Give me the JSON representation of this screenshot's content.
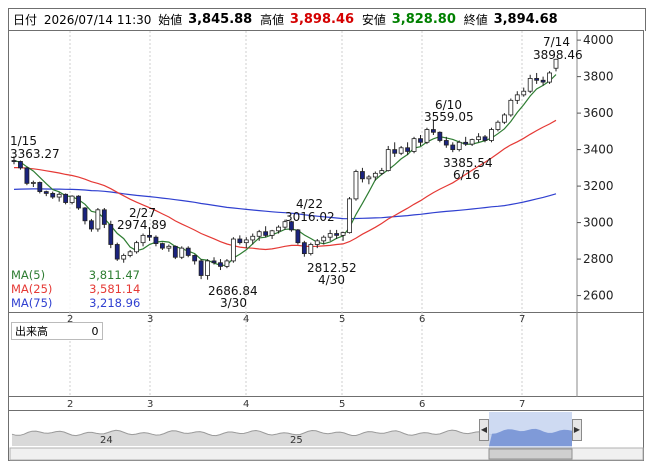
{
  "header": {
    "date_label": "日付",
    "datetime": "2026/07/14 11:30",
    "open_label": "始値",
    "open": "3,845.88",
    "high_label": "高値",
    "high": "3,898.46",
    "low_label": "安値",
    "low": "3,828.80",
    "close_label": "終値",
    "close": "3,894.68",
    "colors": {
      "high": "#d40000",
      "low": "#008000",
      "value": "#000000"
    }
  },
  "chart_data": {
    "type": "candlestick",
    "y_ticks": [
      "4000",
      "3800",
      "3600",
      "3400",
      "3200",
      "3000",
      "2800",
      "2600"
    ],
    "ylim": [
      2510,
      4050
    ],
    "x_ticks": [
      "2",
      "3",
      "4",
      "5",
      "6",
      "7"
    ],
    "annotations": [
      {
        "date": "1/15",
        "value": "3363.27"
      },
      {
        "date": "2/27",
        "value": "2974.89"
      },
      {
        "date": "3/30",
        "value": "2686.84"
      },
      {
        "date": "4/22",
        "value": "3016.02"
      },
      {
        "date": "4/30",
        "value": "2812.52"
      },
      {
        "date": "6/10",
        "value": "3559.05"
      },
      {
        "date": "6/16",
        "value": "3385.54"
      },
      {
        "date": "7/14",
        "value": "3898.46"
      }
    ],
    "ma_legend": [
      {
        "name": "MA(5)",
        "value": "3,811.47",
        "color": "#2e7d32"
      },
      {
        "name": "MA(25)",
        "value": "3,581.14",
        "color": "#e53935"
      },
      {
        "name": "MA(75)",
        "value": "3,218.96",
        "color": "#3040d0"
      }
    ],
    "candles": [
      [
        3340,
        3363,
        3320,
        3335
      ],
      [
        3335,
        3340,
        3290,
        3300
      ],
      [
        3300,
        3305,
        3205,
        3215
      ],
      [
        3215,
        3230,
        3195,
        3220
      ],
      [
        3220,
        3225,
        3160,
        3170
      ],
      [
        3170,
        3175,
        3145,
        3160
      ],
      [
        3160,
        3170,
        3130,
        3140
      ],
      [
        3140,
        3165,
        3115,
        3155
      ],
      [
        3155,
        3160,
        3100,
        3110
      ],
      [
        3110,
        3150,
        3100,
        3145
      ],
      [
        3145,
        3150,
        3070,
        3080
      ],
      [
        3080,
        3085,
        2990,
        3010
      ],
      [
        3010,
        3020,
        2950,
        2965
      ],
      [
        2965,
        3080,
        2950,
        3070
      ],
      [
        3070,
        3080,
        2970,
        2990
      ],
      [
        2990,
        3010,
        2860,
        2880
      ],
      [
        2880,
        2890,
        2790,
        2800
      ],
      [
        2800,
        2830,
        2780,
        2820
      ],
      [
        2820,
        2850,
        2810,
        2840
      ],
      [
        2840,
        2900,
        2830,
        2890
      ],
      [
        2890,
        2940,
        2870,
        2930
      ],
      [
        2930,
        2975,
        2900,
        2920
      ],
      [
        2920,
        2930,
        2870,
        2885
      ],
      [
        2885,
        2890,
        2850,
        2860
      ],
      [
        2860,
        2880,
        2840,
        2870
      ],
      [
        2870,
        2875,
        2800,
        2810
      ],
      [
        2810,
        2870,
        2800,
        2860
      ],
      [
        2860,
        2870,
        2810,
        2820
      ],
      [
        2820,
        2825,
        2770,
        2790
      ],
      [
        2790,
        2800,
        2690,
        2710
      ],
      [
        2710,
        2800,
        2687,
        2790
      ],
      [
        2790,
        2810,
        2770,
        2780
      ],
      [
        2780,
        2800,
        2740,
        2760
      ],
      [
        2760,
        2800,
        2750,
        2790
      ],
      [
        2790,
        2920,
        2780,
        2910
      ],
      [
        2910,
        2930,
        2880,
        2890
      ],
      [
        2890,
        2920,
        2860,
        2905
      ],
      [
        2905,
        2940,
        2880,
        2925
      ],
      [
        2925,
        2960,
        2900,
        2950
      ],
      [
        2950,
        2980,
        2920,
        2930
      ],
      [
        2930,
        2960,
        2910,
        2955
      ],
      [
        2955,
        2985,
        2940,
        2975
      ],
      [
        2975,
        3016,
        2960,
        3005
      ],
      [
        3005,
        3010,
        2950,
        2960
      ],
      [
        2960,
        2965,
        2880,
        2890
      ],
      [
        2890,
        2900,
        2813,
        2830
      ],
      [
        2830,
        2890,
        2820,
        2880
      ],
      [
        2880,
        2910,
        2860,
        2900
      ],
      [
        2900,
        2930,
        2880,
        2920
      ],
      [
        2920,
        2960,
        2900,
        2940
      ],
      [
        2940,
        2960,
        2910,
        2930
      ],
      [
        2930,
        2950,
        2900,
        2945
      ],
      [
        2945,
        3140,
        2940,
        3130
      ],
      [
        3130,
        3290,
        3120,
        3280
      ],
      [
        3280,
        3300,
        3220,
        3240
      ],
      [
        3240,
        3260,
        3210,
        3250
      ],
      [
        3250,
        3280,
        3230,
        3270
      ],
      [
        3270,
        3300,
        3260,
        3285
      ],
      [
        3285,
        3420,
        3280,
        3400
      ],
      [
        3400,
        3440,
        3360,
        3380
      ],
      [
        3380,
        3420,
        3370,
        3410
      ],
      [
        3410,
        3440,
        3370,
        3390
      ],
      [
        3390,
        3470,
        3380,
        3460
      ],
      [
        3460,
        3480,
        3420,
        3440
      ],
      [
        3440,
        3520,
        3430,
        3510
      ],
      [
        3510,
        3559,
        3480,
        3495
      ],
      [
        3495,
        3500,
        3440,
        3450
      ],
      [
        3450,
        3470,
        3410,
        3425
      ],
      [
        3425,
        3440,
        3386,
        3400
      ],
      [
        3400,
        3450,
        3390,
        3440
      ],
      [
        3440,
        3470,
        3420,
        3430
      ],
      [
        3430,
        3460,
        3420,
        3455
      ],
      [
        3455,
        3490,
        3440,
        3470
      ],
      [
        3470,
        3480,
        3440,
        3450
      ],
      [
        3450,
        3520,
        3440,
        3510
      ],
      [
        3510,
        3560,
        3500,
        3550
      ],
      [
        3550,
        3600,
        3540,
        3590
      ],
      [
        3590,
        3680,
        3580,
        3670
      ],
      [
        3670,
        3720,
        3650,
        3700
      ],
      [
        3700,
        3740,
        3690,
        3720
      ],
      [
        3720,
        3810,
        3710,
        3790
      ],
      [
        3790,
        3820,
        3760,
        3780
      ],
      [
        3780,
        3800,
        3750,
        3770
      ],
      [
        3770,
        3830,
        3760,
        3820
      ],
      [
        3846,
        3898,
        3829,
        3895
      ]
    ]
  },
  "volume_panel": {
    "label": "出来高",
    "value": "0"
  },
  "navigator": {
    "labels": [
      "24",
      "25"
    ]
  },
  "icons": {
    "nav_left": "arrow-left-icon",
    "nav_right": "arrow-right-icon"
  }
}
